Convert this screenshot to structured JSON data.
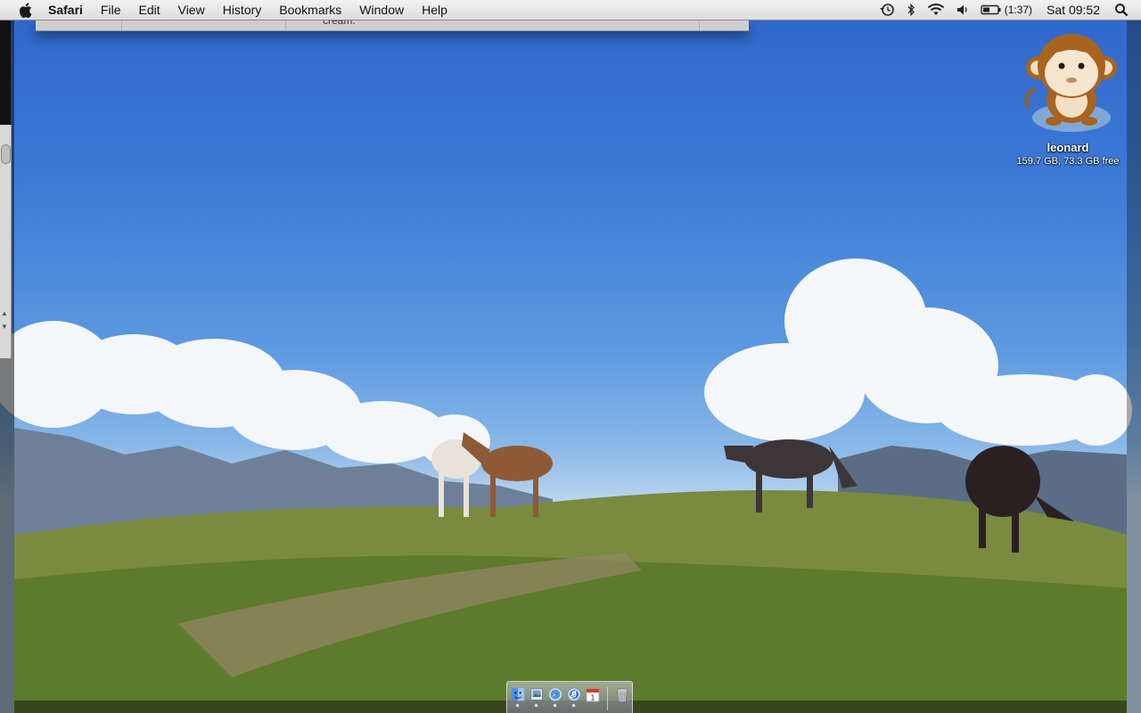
{
  "menubar": {
    "apple_icon": "apple-icon",
    "app_name": "Safari",
    "items": [
      "File",
      "Edit",
      "View",
      "History",
      "Bookmarks",
      "Window",
      "Help"
    ],
    "status": {
      "time_machine_icon": "time-machine-icon",
      "bluetooth_icon": "bluetooth-icon",
      "wifi_icon": "wifi-icon",
      "volume_icon": "volume-icon",
      "battery_icon": "battery-icon",
      "battery_time": "(1:37)",
      "clock": "Sat 09:52",
      "spotlight_icon": "spotlight-icon"
    }
  },
  "background_window": {
    "visible_text": "cream."
  },
  "desktop": {
    "disk": {
      "name": "leonard",
      "info": "159.7 GB, 73.3 GB free",
      "icon": "monkey-disk-icon"
    }
  },
  "dock": {
    "items": [
      {
        "name": "finder",
        "icon": "finder-icon",
        "running": true
      },
      {
        "name": "preview",
        "icon": "preview-icon",
        "running": true
      },
      {
        "name": "safari",
        "icon": "safari-icon",
        "running": true
      },
      {
        "name": "itunes",
        "icon": "itunes-icon",
        "running": true
      },
      {
        "name": "ical",
        "icon": "calendar-icon",
        "running": false,
        "date": "1"
      }
    ],
    "trash_icon": "trash-icon"
  }
}
